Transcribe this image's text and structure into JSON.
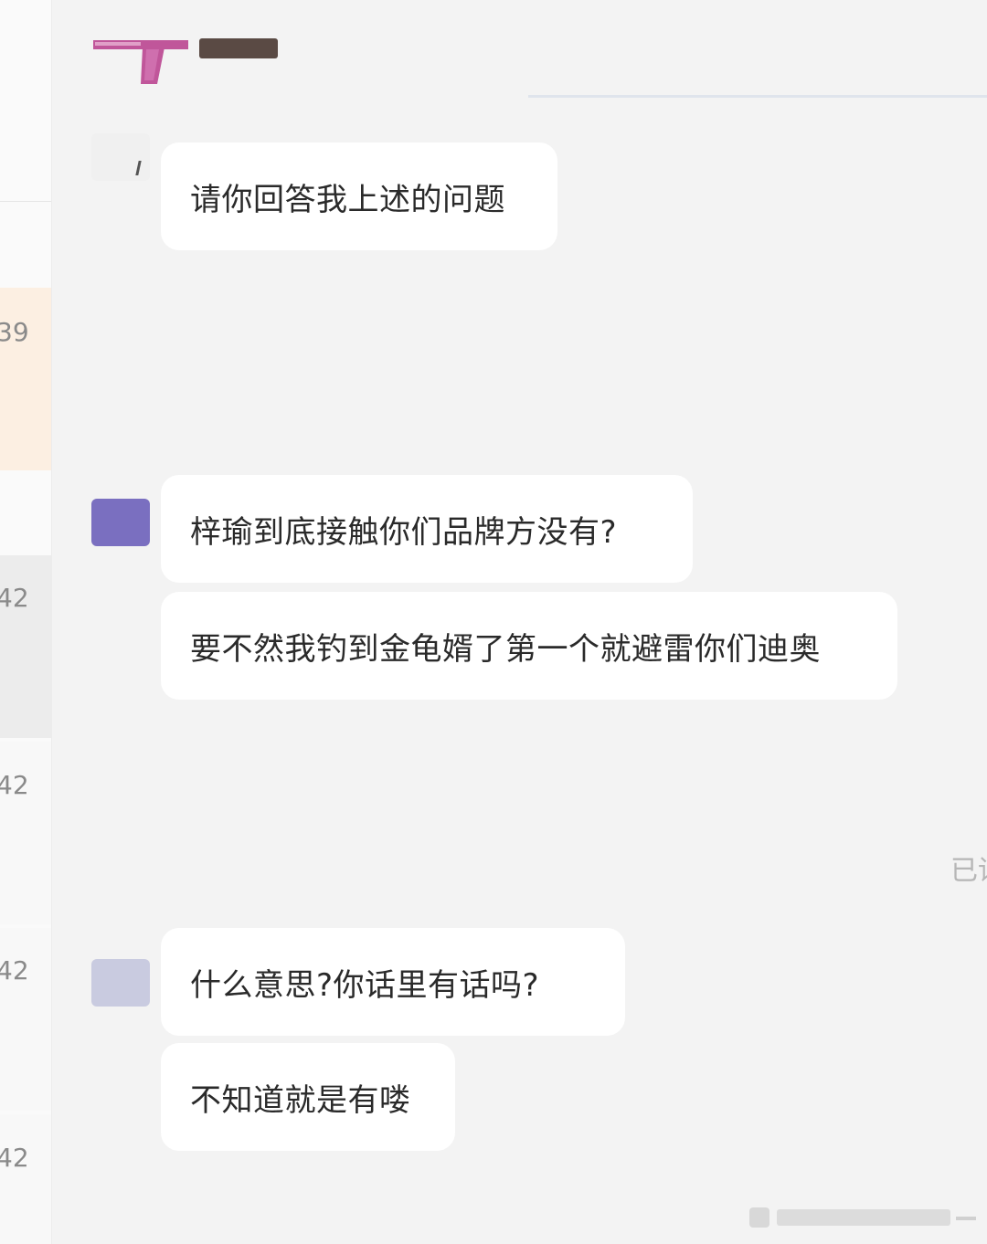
{
  "conversation": {
    "messages": [
      {
        "text": "请你回答我上述的问题"
      },
      {
        "text": "梓瑜到底接触你们品牌方没有?"
      },
      {
        "text": "要不然我钓到金龟婿了第一个就避雷你们迪奥"
      },
      {
        "text": "什么意思?你话里有话吗?"
      },
      {
        "text": "不知道就是有喽"
      }
    ],
    "read_status": "已读"
  },
  "sidebar": {
    "items": [
      {
        "time": "39"
      },
      {
        "time": "42"
      },
      {
        "time": "42"
      },
      {
        "time": "42"
      },
      {
        "time": "42"
      }
    ]
  },
  "colors": {
    "background": "#f3f3f3",
    "bubble": "#ffffff",
    "highlight_cell": "#fcefe2",
    "selected_cell": "#ececec",
    "logo_pink": "#c0569a"
  }
}
